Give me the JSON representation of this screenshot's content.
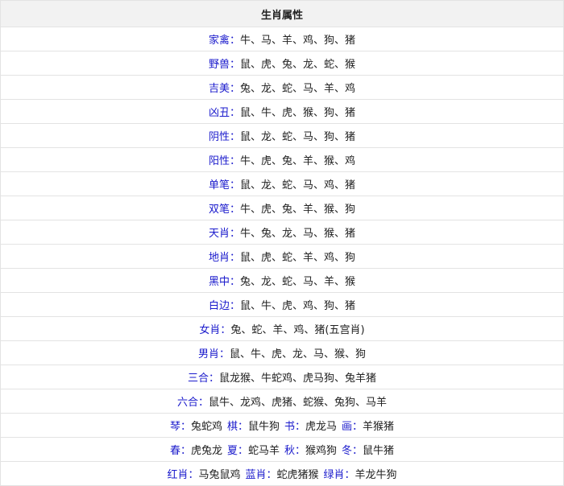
{
  "table": {
    "title": "生肖属性",
    "rows": [
      [
        {
          "label": "家禽：",
          "value": "牛、马、羊、鸡、狗、猪"
        }
      ],
      [
        {
          "label": "野兽：",
          "value": "鼠、虎、兔、龙、蛇、猴"
        }
      ],
      [
        {
          "label": "吉美：",
          "value": "兔、龙、蛇、马、羊、鸡"
        }
      ],
      [
        {
          "label": "凶丑：",
          "value": "鼠、牛、虎、猴、狗、猪"
        }
      ],
      [
        {
          "label": "阴性：",
          "value": "鼠、龙、蛇、马、狗、猪"
        }
      ],
      [
        {
          "label": "阳性：",
          "value": "牛、虎、兔、羊、猴、鸡"
        }
      ],
      [
        {
          "label": "单笔：",
          "value": "鼠、龙、蛇、马、鸡、猪"
        }
      ],
      [
        {
          "label": "双笔：",
          "value": "牛、虎、兔、羊、猴、狗"
        }
      ],
      [
        {
          "label": "天肖：",
          "value": "牛、兔、龙、马、猴、猪"
        }
      ],
      [
        {
          "label": "地肖：",
          "value": "鼠、虎、蛇、羊、鸡、狗"
        }
      ],
      [
        {
          "label": "黑中：",
          "value": "兔、龙、蛇、马、羊、猴"
        }
      ],
      [
        {
          "label": "白边：",
          "value": "鼠、牛、虎、鸡、狗、猪"
        }
      ],
      [
        {
          "label": "女肖：",
          "value": "兔、蛇、羊、鸡、猪(五宫肖)"
        }
      ],
      [
        {
          "label": "男肖：",
          "value": "鼠、牛、虎、龙、马、猴、狗"
        }
      ],
      [
        {
          "label": "三合：",
          "value": "鼠龙猴、牛蛇鸡、虎马狗、兔羊猪"
        }
      ],
      [
        {
          "label": "六合：",
          "value": "鼠牛、龙鸡、虎猪、蛇猴、兔狗、马羊"
        }
      ],
      [
        {
          "label": "琴：",
          "value": "兔蛇鸡"
        },
        {
          "label": "棋：",
          "value": "鼠牛狗"
        },
        {
          "label": "书：",
          "value": "虎龙马"
        },
        {
          "label": "画：",
          "value": "羊猴猪"
        }
      ],
      [
        {
          "label": "春：",
          "value": "虎兔龙"
        },
        {
          "label": "夏：",
          "value": "蛇马羊"
        },
        {
          "label": "秋：",
          "value": "猴鸡狗"
        },
        {
          "label": "冬：",
          "value": "鼠牛猪"
        }
      ],
      [
        {
          "label": "红肖：",
          "value": "马兔鼠鸡"
        },
        {
          "label": "蓝肖：",
          "value": "蛇虎猪猴"
        },
        {
          "label": "绿肖：",
          "value": "羊龙牛狗"
        }
      ]
    ]
  }
}
